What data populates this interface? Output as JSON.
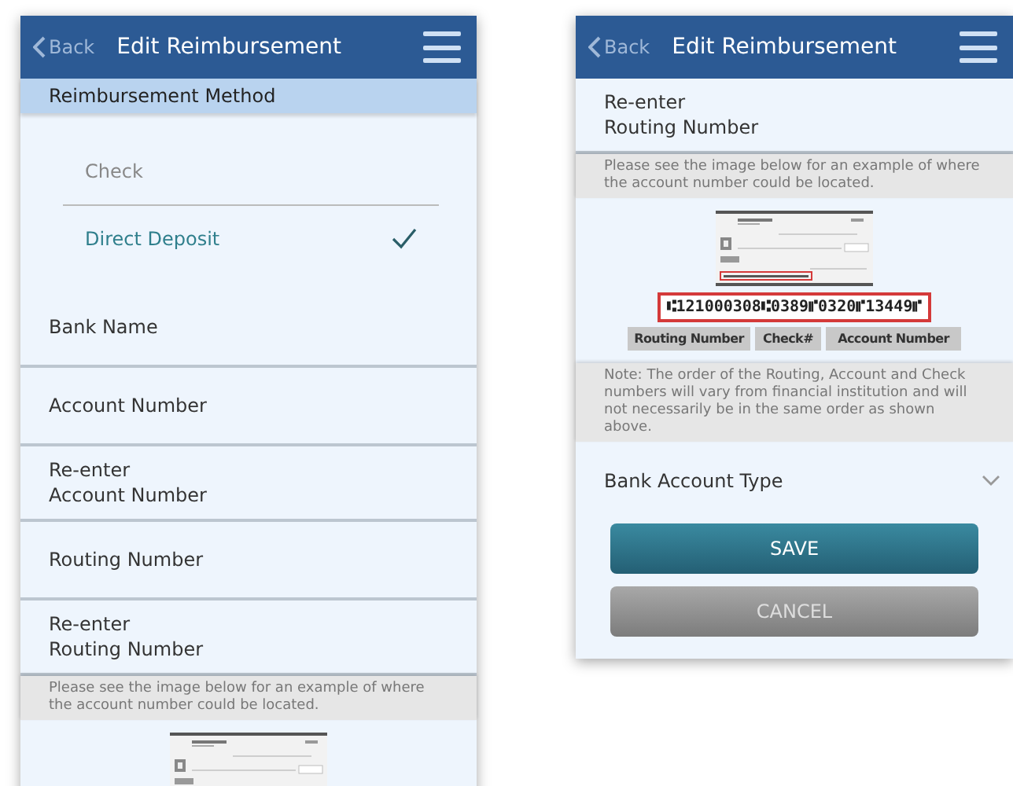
{
  "screens": [
    {
      "header": {
        "back": "Back",
        "title": "Edit Reimbursement"
      },
      "sections": [
        {
          "kind": "section_header",
          "label": "Reimbursement Method"
        },
        {
          "kind": "radio_group",
          "options": [
            {
              "label": "Check",
              "selected": false
            },
            {
              "label": "Direct Deposit",
              "selected": true
            }
          ]
        },
        {
          "kind": "field",
          "label": "Bank Name"
        },
        {
          "kind": "field",
          "label": "Account Number"
        },
        {
          "kind": "field",
          "label": "Re-enter\nAccount Number"
        },
        {
          "kind": "field",
          "label": "Routing Number"
        },
        {
          "kind": "field",
          "label": "Re-enter\nRouting Number"
        },
        {
          "kind": "note",
          "text": "Please see the image below for an example of where the account number could be located."
        },
        {
          "kind": "check_image"
        }
      ]
    },
    {
      "header": {
        "back": "Back",
        "title": "Edit Reimbursement"
      },
      "sections": [
        {
          "kind": "field",
          "label": "Re-enter\nRouting Number"
        },
        {
          "kind": "note",
          "text": "Please see the image below for an example of where the account number could be located."
        },
        {
          "kind": "check_image",
          "micr": "⑆121000308⑆0389⑈0320⑈13449⑈",
          "labels": [
            "Routing Number",
            "Check#",
            "Account Number"
          ]
        },
        {
          "kind": "note",
          "text": "Note: The order of the Routing, Account and Check numbers will vary from financial institution and will not necessarily be in the same order as shown above."
        },
        {
          "kind": "dropdown",
          "label": "Bank Account Type"
        },
        {
          "kind": "buttons",
          "buttons": [
            {
              "label": "SAVE",
              "kind": "primary"
            },
            {
              "label": "CANCEL",
              "kind": "secondary"
            }
          ]
        }
      ]
    }
  ]
}
